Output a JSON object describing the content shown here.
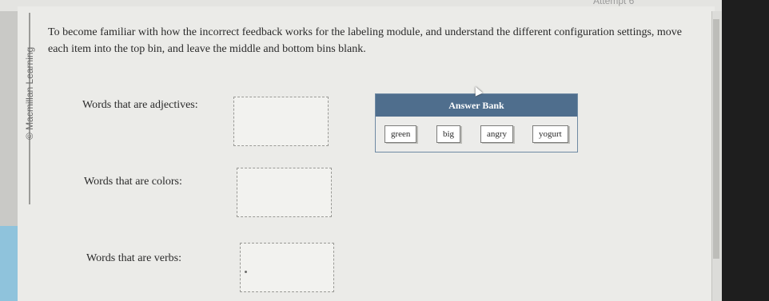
{
  "header": {
    "attempt_label": "Attempt 6"
  },
  "sidebar": {
    "copyright": "© Macmillan Learning"
  },
  "instructions": "To become familiar with how the incorrect feedback works for the labeling module, and understand the different configuration settings, move each item into the top bin, and leave the middle and bottom bins blank.",
  "bins": [
    {
      "label": "Words that are adjectives:"
    },
    {
      "label": "Words that are colors:"
    },
    {
      "label": "Words that are verbs:"
    }
  ],
  "answer_bank": {
    "title": "Answer Bank",
    "items": [
      "green",
      "big",
      "angry",
      "yogurt"
    ]
  }
}
